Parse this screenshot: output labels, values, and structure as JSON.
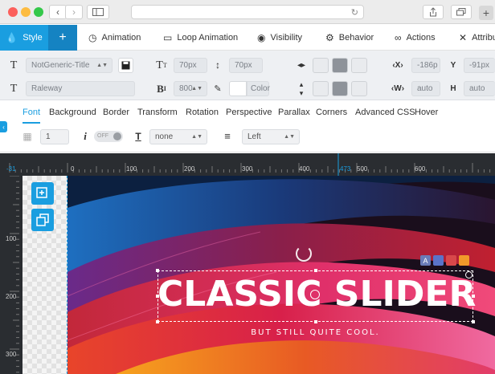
{
  "tabs": [
    {
      "label": "Style",
      "icon": "drop-icon",
      "active": true
    },
    {
      "label": "+",
      "icon": "add-icon"
    },
    {
      "label": "Animation",
      "icon": "clock-icon"
    },
    {
      "label": "Loop Animation",
      "icon": "loop-icon"
    },
    {
      "label": "Visibility",
      "icon": "eye-icon"
    },
    {
      "label": "Behavior",
      "icon": "behavior-icon"
    },
    {
      "label": "Actions",
      "icon": "link-icon"
    },
    {
      "label": "Attribu",
      "icon": "tools-icon"
    }
  ],
  "props": {
    "font_class": "NotGeneric-Title",
    "font_family": "Raleway",
    "font_size": "70px",
    "line_height": "70px",
    "font_weight": "800",
    "color_label": "Color",
    "x_value": "-186p",
    "y_value": "-91px",
    "w_value": "auto",
    "h_value": "auto",
    "x_label": "X",
    "y_label": "Y",
    "w_label": "W",
    "h_label": "H"
  },
  "subtabs": [
    "Font",
    "Background",
    "Border",
    "Transform",
    "Rotation",
    "Perspective",
    "Parallax",
    "Corners",
    "Advanced CSS",
    "Hover"
  ],
  "subprops": {
    "opacity_value": "1",
    "italic_toggle": "OFF",
    "text_transform": "none",
    "text_align": "Left"
  },
  "ruler": {
    "h_marks": [
      "0",
      "100",
      "200",
      "300",
      "400",
      "500",
      "600"
    ],
    "h_left": "-31",
    "h_marker": "473",
    "v_marks": [
      "100",
      "200",
      "300"
    ]
  },
  "slide": {
    "title": "CLASSIC SLIDER",
    "subtitle": "BUT STILL QUITE COOL."
  },
  "colors": {
    "accent": "#1a9ee0",
    "ruler": "#2a2d31"
  }
}
